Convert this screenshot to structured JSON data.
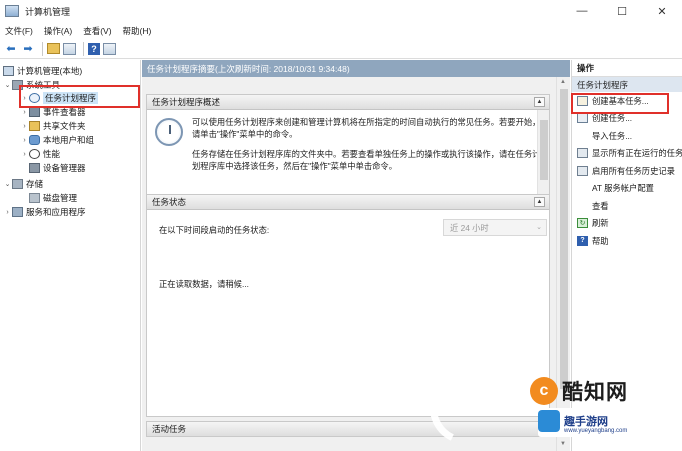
{
  "window": {
    "title": "计算机管理",
    "controls": {
      "minimize": "—",
      "maximize": "☐",
      "close": "✕"
    }
  },
  "menu": [
    "文件(F)",
    "操作(A)",
    "查看(V)",
    "帮助(H)"
  ],
  "toolbar": {
    "icons": [
      "back-arrow-icon",
      "forward-arrow-icon",
      "up-folder-icon",
      "show-hide-tree-icon",
      "help-icon",
      "properties-icon"
    ]
  },
  "tree": {
    "root": "计算机管理(本地)",
    "system_tools": "系统工具",
    "items": {
      "task_scheduler": "任务计划程序",
      "event_viewer": "事件查看器",
      "shared_folders": "共享文件夹",
      "local_users": "本地用户和组",
      "performance": "性能",
      "device_manager": "设备管理器"
    },
    "storage": "存储",
    "disk_management": "磁盘管理",
    "services_apps": "服务和应用程序"
  },
  "center": {
    "header": "任务计划程序摘要(上次刷新时间: 2018/10/31 9:34:48)",
    "overview": {
      "title": "任务计划程序概述",
      "para1": "可以使用任务计划程序来创建和管理计算机将在所指定的时间自动执行的常见任务。若要开始，请单击\"操作\"菜单中的命令。",
      "para2": "任务存储在任务计划程序库的文件夹中。若要查看单独任务上的操作或执行该操作，请在任务计划程序库中选择该任务，然后在\"操作\"菜单中单击命令。"
    },
    "status": {
      "title": "任务状态",
      "period_label": "在以下时间段启动的任务状态:",
      "period_value": "近 24 小时",
      "loading": "正在读取数据，请稍候..."
    },
    "active": {
      "title": "活动任务"
    }
  },
  "actions": {
    "header": "操作",
    "subheader": "任务计划程序",
    "items": [
      {
        "label": "创建基本任务...",
        "icon": "task-icon"
      },
      {
        "label": "创建任务...",
        "icon": "create-task-icon"
      },
      {
        "label": "导入任务...",
        "icon": ""
      },
      {
        "label": "显示所有正在运行的任务",
        "icon": "running-tasks-icon"
      },
      {
        "label": "启用所有任务历史记录",
        "icon": "history-icon"
      },
      {
        "label": "AT 服务帐户配置",
        "icon": ""
      },
      {
        "label": "查看",
        "icon": ""
      },
      {
        "label": "刷新",
        "icon": "refresh-icon"
      },
      {
        "label": "帮助",
        "icon": "help-icon"
      }
    ]
  },
  "watermark": {
    "brand": "酷知网",
    "sub": "趣手游网",
    "url": "www.yueyangbang.com",
    "badge": "c"
  },
  "colors": {
    "highlight_box": "#e0302a",
    "center_header": "#8fa6be",
    "selection": "#cce4f7"
  }
}
